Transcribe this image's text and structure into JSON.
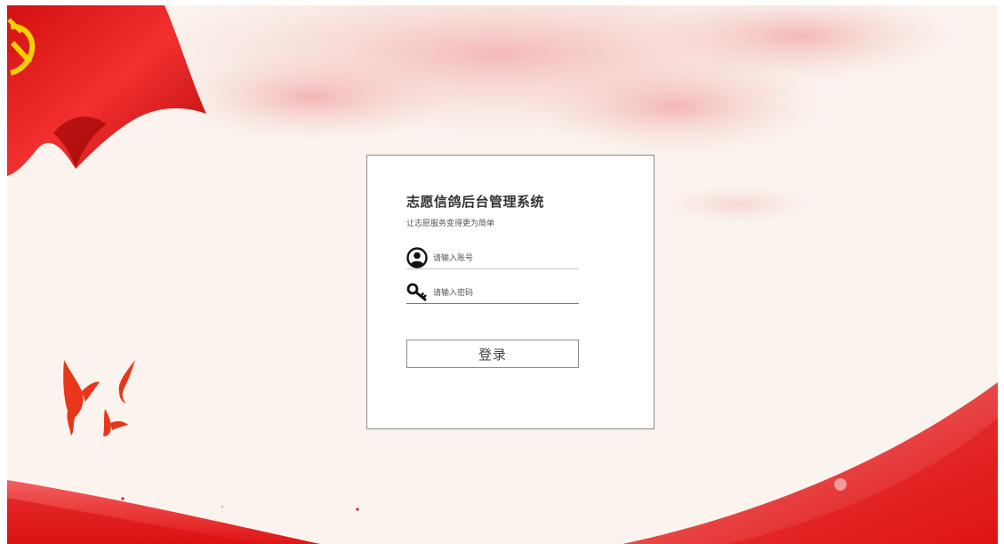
{
  "login": {
    "title": "志愿信鸽后台管理系统",
    "subtitle": "让志愿服务变得更为简单",
    "username_placeholder": "请输入账号",
    "password_placeholder": "请输入密码",
    "submit_label": "登录"
  },
  "icons": {
    "username": "user-icon",
    "password": "key-icon",
    "flag": "party-flag-icon",
    "doves": "dove-icon"
  },
  "theme": {
    "background": "#faf3ee",
    "accent_red": "#e32020",
    "card_border": "#8d8d8d",
    "title_color": "#333333"
  }
}
